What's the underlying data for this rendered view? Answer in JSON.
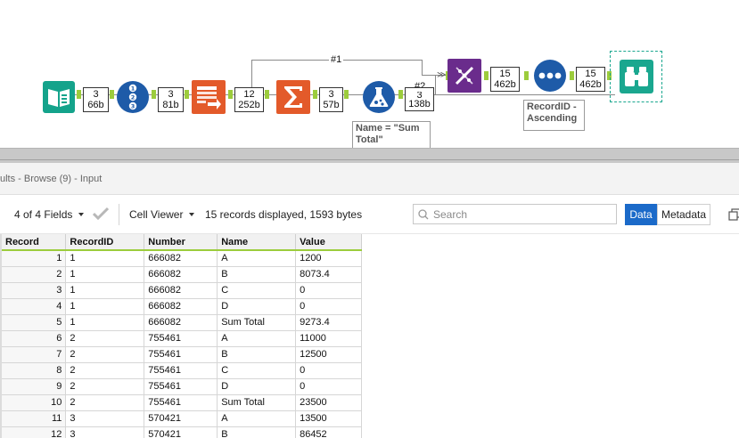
{
  "workflow": {
    "connection_labels": {
      "top_wire": "#1",
      "second_wire": "#2"
    },
    "badges": [
      {
        "count": "3",
        "size": "66b"
      },
      {
        "count": "3",
        "size": "81b"
      },
      {
        "count": "12",
        "size": "252b"
      },
      {
        "count": "3",
        "size": "57b"
      },
      {
        "count": "3",
        "size": "138b"
      },
      {
        "count": "15",
        "size": "462b"
      },
      {
        "count": "15",
        "size": "462b"
      }
    ],
    "annotations": {
      "formula": "Name = \"Sum Total\"",
      "sort": "RecordID - Ascending"
    },
    "tool_icons": [
      "text-input-icon",
      "record-id-icon",
      "transpose-icon",
      "summarize-icon",
      "formula-icon",
      "transform-icon",
      "sort-icon",
      "browse-icon"
    ],
    "colors": {
      "input_teal": "#14a38b",
      "id_blue": "#1e5ba8",
      "orange": "#e35a2a",
      "purple": "#6a2c8c",
      "anchor_green": "#9ccc3c",
      "selected_teal": "#1aa78f"
    }
  },
  "results": {
    "title": "ults - Browse (9) - Input",
    "toolbar": {
      "fields": "4 of 4 Fields",
      "cell_viewer": "Cell Viewer",
      "status": "15 records displayed, 1593 bytes",
      "search_placeholder": "Search",
      "data_tab": "Data",
      "metadata_tab": "Metadata"
    },
    "columns": [
      "Record",
      "RecordID",
      "Number",
      "Name",
      "Value"
    ],
    "rows": [
      [
        "1",
        "1",
        "666082",
        "A",
        "1200"
      ],
      [
        "2",
        "1",
        "666082",
        "B",
        "8073.4"
      ],
      [
        "3",
        "1",
        "666082",
        "C",
        "0"
      ],
      [
        "4",
        "1",
        "666082",
        "D",
        "0"
      ],
      [
        "5",
        "1",
        "666082",
        "Sum Total",
        "9273.4"
      ],
      [
        "6",
        "2",
        "755461",
        "A",
        "11000"
      ],
      [
        "7",
        "2",
        "755461",
        "B",
        "12500"
      ],
      [
        "8",
        "2",
        "755461",
        "C",
        "0"
      ],
      [
        "9",
        "2",
        "755461",
        "D",
        "0"
      ],
      [
        "10",
        "2",
        "755461",
        "Sum Total",
        "23500"
      ],
      [
        "11",
        "3",
        "570421",
        "A",
        "13500"
      ],
      [
        "12",
        "3",
        "570421",
        "B",
        "86452"
      ]
    ]
  }
}
